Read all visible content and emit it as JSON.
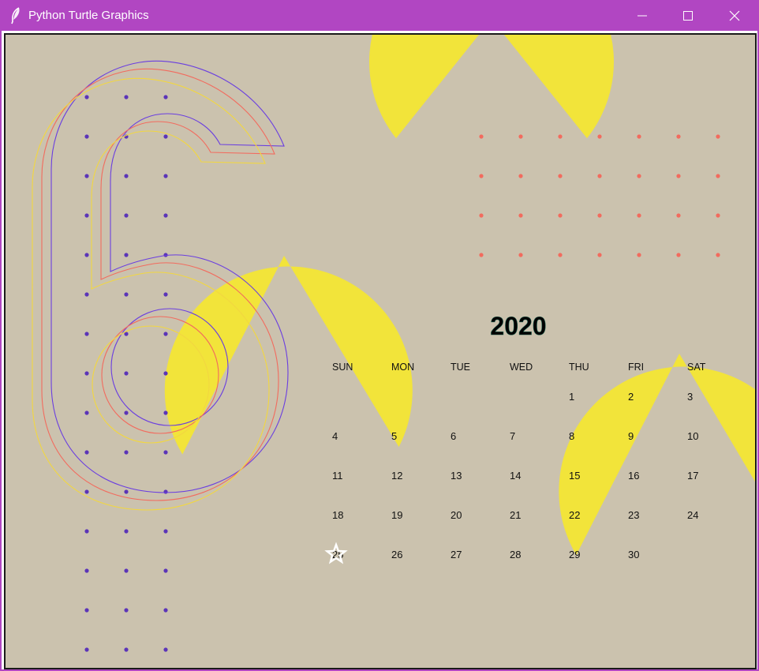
{
  "window": {
    "title": "Python Turtle Graphics",
    "icon": "feather-icon",
    "controls": {
      "minimize": "minimize-icon",
      "maximize": "maximize-icon",
      "close": "close-icon"
    },
    "titlebar_color": "#b146c2"
  },
  "canvas": {
    "background": "#cbc2ae",
    "drop_color": "#f2e43a",
    "dot_colors": {
      "left_grid": "#5b34b8",
      "right_grid": "#f26b5e"
    },
    "numeral": {
      "text": "6",
      "stroke_colors": [
        "#6a3ee0",
        "#f26b5e",
        "#f2d740"
      ]
    },
    "cursor_icon": "turtle-star-icon"
  },
  "calendar": {
    "year": "2020",
    "weekdays": [
      "SUN",
      "MON",
      "TUE",
      "WED",
      "THU",
      "FRI",
      "SAT"
    ],
    "weeks": [
      [
        "",
        "",
        "",
        "",
        "1",
        "2",
        "3"
      ],
      [
        "4",
        "5",
        "6",
        "7",
        "8",
        "9",
        "10"
      ],
      [
        "11",
        "12",
        "13",
        "14",
        "15",
        "16",
        "17"
      ],
      [
        "18",
        "19",
        "20",
        "21",
        "22",
        "23",
        "24"
      ],
      [
        "25",
        "26",
        "27",
        "28",
        "29",
        "30",
        ""
      ]
    ]
  }
}
